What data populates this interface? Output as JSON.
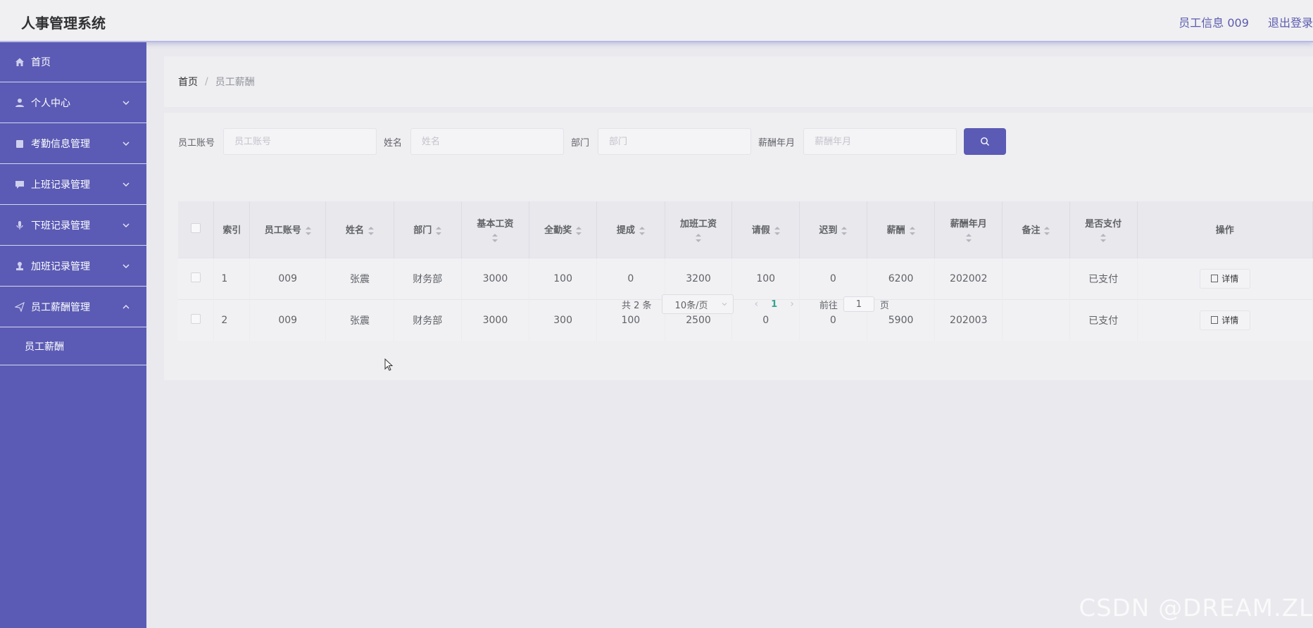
{
  "header": {
    "title": "人事管理系统",
    "user_info": "员工信息 009",
    "logout": "退出登录"
  },
  "sidebar": {
    "items": [
      {
        "label": "首页",
        "icon": "home-icon"
      },
      {
        "label": "个人中心",
        "icon": "user-icon"
      },
      {
        "label": "考勤信息管理",
        "icon": "clipboard-icon"
      },
      {
        "label": "上班记录管理",
        "icon": "chat-icon"
      },
      {
        "label": "下班记录管理",
        "icon": "microphone-icon"
      },
      {
        "label": "加班记录管理",
        "icon": "stamp-icon"
      },
      {
        "label": "员工薪酬管理",
        "icon": "send-icon"
      }
    ],
    "sub_item": "员工薪酬"
  },
  "breadcrumb": {
    "home": "首页",
    "sep": "/",
    "current": "员工薪酬"
  },
  "search": {
    "fields": [
      {
        "label": "员工账号",
        "placeholder": "员工账号"
      },
      {
        "label": "姓名",
        "placeholder": "姓名"
      },
      {
        "label": "部门",
        "placeholder": "部门"
      },
      {
        "label": "薪酬年月",
        "placeholder": "薪酬年月"
      }
    ]
  },
  "table": {
    "headers": [
      "索引",
      "员工账号",
      "姓名",
      "部门",
      "基本工资",
      "全勤奖",
      "提成",
      "加班工资",
      "请假",
      "迟到",
      "薪酬",
      "薪酬年月",
      "备注",
      "是否支付",
      "操作"
    ],
    "rows": [
      [
        "1",
        "009",
        "张震",
        "财务部",
        "3000",
        "100",
        "0",
        "3200",
        "100",
        "0",
        "6200",
        "202002",
        "",
        "已支付"
      ],
      [
        "2",
        "009",
        "张震",
        "财务部",
        "3000",
        "300",
        "100",
        "2500",
        "0",
        "0",
        "5900",
        "202003",
        "",
        "已支付"
      ]
    ],
    "detail_label": "详情"
  },
  "pagination": {
    "total": "共 2 条",
    "page_size": "10条/页",
    "current": "1",
    "goto_prefix": "前往",
    "goto_value": "1",
    "goto_suffix": "页"
  },
  "watermark": "CSDN @DREAM.ZL",
  "colors": {
    "primary": "#5b5bb5",
    "active_page": "#36a58f"
  }
}
